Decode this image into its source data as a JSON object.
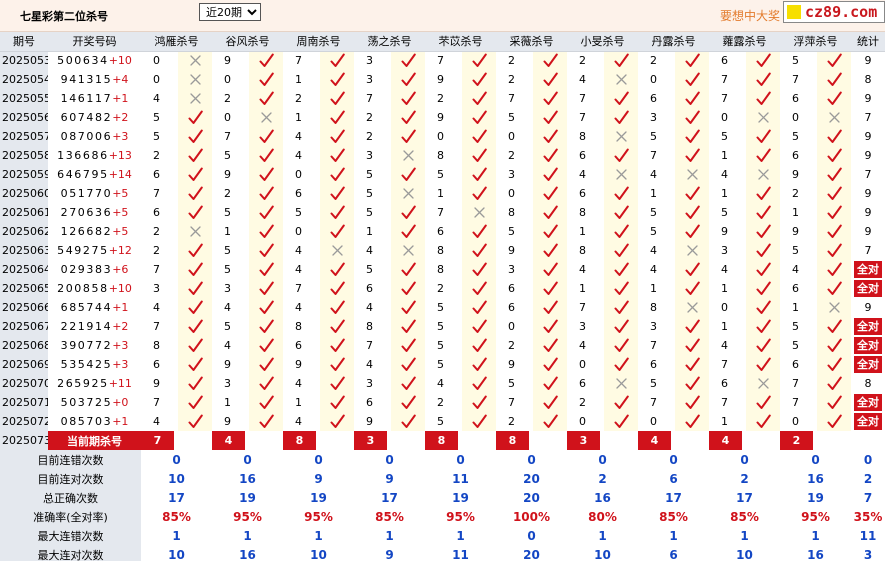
{
  "header": {
    "title": "七星彩第二位杀号",
    "period_select": {
      "selected": "近20期",
      "options": [
        "近20期"
      ]
    },
    "slogan": "要想中大奖",
    "logo_text": "cz89.com"
  },
  "table": {
    "col_issue": "期号",
    "col_numbers": "开奖号码",
    "col_stat": "统计",
    "experts": [
      "鸿雁杀号",
      "谷风杀号",
      "周南杀号",
      "荡之杀号",
      "芣苡杀号",
      "采薇杀号",
      "小旻杀号",
      "丹露杀号",
      "蕹露杀号",
      "浮萍杀号"
    ],
    "full_label": "全对",
    "rows": [
      {
        "issue": "2025053",
        "numbers": "500634",
        "plus": "+10",
        "kills": [
          "0",
          "9",
          "7",
          "3",
          "7",
          "2",
          "2",
          "2",
          "6",
          "5"
        ],
        "marks": [
          0,
          1,
          1,
          1,
          1,
          1,
          1,
          1,
          1,
          1
        ],
        "stat": "9"
      },
      {
        "issue": "2025054",
        "numbers": "941315",
        "plus": "+4",
        "kills": [
          "0",
          "0",
          "1",
          "3",
          "9",
          "2",
          "4",
          "0",
          "7",
          "7"
        ],
        "marks": [
          0,
          1,
          1,
          1,
          1,
          1,
          0,
          1,
          1,
          1
        ],
        "stat": "8"
      },
      {
        "issue": "2025055",
        "numbers": "146117",
        "plus": "+1",
        "kills": [
          "4",
          "2",
          "2",
          "7",
          "2",
          "7",
          "7",
          "6",
          "7",
          "6"
        ],
        "marks": [
          0,
          1,
          1,
          1,
          1,
          1,
          1,
          1,
          1,
          1
        ],
        "stat": "9"
      },
      {
        "issue": "2025056",
        "numbers": "607482",
        "plus": "+2",
        "kills": [
          "5",
          "0",
          "1",
          "2",
          "9",
          "5",
          "7",
          "3",
          "0",
          "0"
        ],
        "marks": [
          1,
          0,
          1,
          1,
          1,
          1,
          1,
          1,
          0,
          0
        ],
        "stat": "7"
      },
      {
        "issue": "2025057",
        "numbers": "087006",
        "plus": "+3",
        "kills": [
          "5",
          "7",
          "4",
          "2",
          "0",
          "0",
          "8",
          "5",
          "5",
          "5"
        ],
        "marks": [
          1,
          1,
          1,
          1,
          1,
          1,
          0,
          1,
          1,
          1
        ],
        "stat": "9"
      },
      {
        "issue": "2025058",
        "numbers": "136686",
        "plus": "+13",
        "kills": [
          "2",
          "5",
          "4",
          "3",
          "8",
          "2",
          "6",
          "7",
          "1",
          "6"
        ],
        "marks": [
          1,
          1,
          1,
          0,
          1,
          1,
          1,
          1,
          1,
          1
        ],
        "stat": "9"
      },
      {
        "issue": "2025059",
        "numbers": "646795",
        "plus": "+14",
        "kills": [
          "6",
          "9",
          "0",
          "5",
          "5",
          "3",
          "4",
          "4",
          "4",
          "9"
        ],
        "marks": [
          1,
          1,
          1,
          1,
          1,
          1,
          0,
          0,
          0,
          1
        ],
        "stat": "7"
      },
      {
        "issue": "2025060",
        "numbers": "051770",
        "plus": "+5",
        "kills": [
          "7",
          "2",
          "6",
          "5",
          "1",
          "0",
          "6",
          "1",
          "1",
          "2"
        ],
        "marks": [
          1,
          1,
          1,
          0,
          1,
          1,
          1,
          1,
          1,
          1
        ],
        "stat": "9"
      },
      {
        "issue": "2025061",
        "numbers": "270636",
        "plus": "+5",
        "kills": [
          "6",
          "5",
          "5",
          "5",
          "7",
          "8",
          "8",
          "5",
          "5",
          "1"
        ],
        "marks": [
          1,
          1,
          1,
          1,
          0,
          1,
          1,
          1,
          1,
          1
        ],
        "stat": "9"
      },
      {
        "issue": "2025062",
        "numbers": "126682",
        "plus": "+5",
        "kills": [
          "2",
          "1",
          "0",
          "1",
          "6",
          "5",
          "1",
          "5",
          "9",
          "9"
        ],
        "marks": [
          0,
          1,
          1,
          1,
          1,
          1,
          1,
          1,
          1,
          1
        ],
        "stat": "9"
      },
      {
        "issue": "2025063",
        "numbers": "549275",
        "plus": "+12",
        "kills": [
          "2",
          "5",
          "4",
          "4",
          "8",
          "9",
          "8",
          "4",
          "3",
          "5"
        ],
        "marks": [
          1,
          1,
          0,
          0,
          1,
          1,
          1,
          0,
          1,
          1
        ],
        "stat": "7"
      },
      {
        "issue": "2025064",
        "numbers": "029383",
        "plus": "+6",
        "kills": [
          "7",
          "5",
          "4",
          "5",
          "8",
          "3",
          "4",
          "4",
          "4",
          "4"
        ],
        "marks": [
          1,
          1,
          1,
          1,
          1,
          1,
          1,
          1,
          1,
          1
        ],
        "stat": "full"
      },
      {
        "issue": "2025065",
        "numbers": "200858",
        "plus": "+10",
        "kills": [
          "3",
          "3",
          "7",
          "6",
          "2",
          "6",
          "1",
          "1",
          "1",
          "6"
        ],
        "marks": [
          1,
          1,
          1,
          1,
          1,
          1,
          1,
          1,
          1,
          1
        ],
        "stat": "full"
      },
      {
        "issue": "2025066",
        "numbers": "685744",
        "plus": "+1",
        "kills": [
          "4",
          "4",
          "4",
          "4",
          "5",
          "6",
          "7",
          "8",
          "0",
          "1"
        ],
        "marks": [
          1,
          1,
          1,
          1,
          1,
          1,
          1,
          0,
          1,
          0
        ],
        "stat": "9"
      },
      {
        "issue": "2025067",
        "numbers": "221914",
        "plus": "+2",
        "kills": [
          "7",
          "5",
          "8",
          "8",
          "5",
          "0",
          "3",
          "3",
          "1",
          "5"
        ],
        "marks": [
          1,
          1,
          1,
          1,
          1,
          1,
          1,
          1,
          1,
          1
        ],
        "stat": "full"
      },
      {
        "issue": "2025068",
        "numbers": "390772",
        "plus": "+3",
        "kills": [
          "8",
          "4",
          "6",
          "7",
          "5",
          "2",
          "4",
          "7",
          "4",
          "5"
        ],
        "marks": [
          1,
          1,
          1,
          1,
          1,
          1,
          1,
          1,
          1,
          1
        ],
        "stat": "full"
      },
      {
        "issue": "2025069",
        "numbers": "535425",
        "plus": "+3",
        "kills": [
          "6",
          "9",
          "9",
          "4",
          "5",
          "9",
          "0",
          "6",
          "7",
          "6"
        ],
        "marks": [
          1,
          1,
          1,
          1,
          1,
          1,
          1,
          1,
          1,
          1
        ],
        "stat": "full"
      },
      {
        "issue": "2025070",
        "numbers": "265925",
        "plus": "+11",
        "kills": [
          "9",
          "3",
          "4",
          "3",
          "4",
          "5",
          "6",
          "5",
          "6",
          "7"
        ],
        "marks": [
          1,
          1,
          1,
          1,
          1,
          1,
          0,
          1,
          0,
          1
        ],
        "stat": "8"
      },
      {
        "issue": "2025071",
        "numbers": "503725",
        "plus": "+0",
        "kills": [
          "7",
          "1",
          "1",
          "6",
          "2",
          "7",
          "2",
          "7",
          "7",
          "7"
        ],
        "marks": [
          1,
          1,
          1,
          1,
          1,
          1,
          1,
          1,
          1,
          1
        ],
        "stat": "full"
      },
      {
        "issue": "2025072",
        "numbers": "085703",
        "plus": "+1",
        "kills": [
          "4",
          "9",
          "4",
          "9",
          "5",
          "2",
          "0",
          "0",
          "1",
          "0"
        ],
        "marks": [
          1,
          1,
          1,
          1,
          1,
          1,
          1,
          1,
          1,
          1
        ],
        "stat": "full"
      }
    ],
    "current": {
      "issue": "2025073",
      "label": "当前期杀号",
      "kills": [
        "7",
        "4",
        "8",
        "3",
        "8",
        "8",
        "3",
        "4",
        "4",
        "2"
      ]
    },
    "summary": [
      {
        "label": "目前连错次数",
        "values": [
          "0",
          "0",
          "0",
          "0",
          "0",
          "0",
          "0",
          "0",
          "0",
          "0"
        ],
        "stat": "0",
        "color": "blue"
      },
      {
        "label": "目前连对次数",
        "values": [
          "10",
          "16",
          "9",
          "9",
          "11",
          "20",
          "2",
          "6",
          "2",
          "16"
        ],
        "stat": "2",
        "color": "blue"
      },
      {
        "label": "总正确次数",
        "values": [
          "17",
          "19",
          "19",
          "17",
          "19",
          "20",
          "16",
          "17",
          "17",
          "19"
        ],
        "stat": "7",
        "color": "blue"
      },
      {
        "label": "准确率(全对率)",
        "values": [
          "85%",
          "95%",
          "95%",
          "85%",
          "95%",
          "100%",
          "80%",
          "85%",
          "85%",
          "95%"
        ],
        "stat": "35%",
        "color": "red"
      },
      {
        "label": "最大连错次数",
        "values": [
          "1",
          "1",
          "1",
          "1",
          "1",
          "0",
          "1",
          "1",
          "1",
          "1"
        ],
        "stat": "11",
        "color": "blue"
      },
      {
        "label": "最大连对次数",
        "values": [
          "10",
          "16",
          "10",
          "9",
          "11",
          "20",
          "10",
          "6",
          "10",
          "16"
        ],
        "stat": "3",
        "color": "blue"
      }
    ],
    "colors": {
      "check": "#d0121b",
      "cross": "#9a9a9a",
      "accent": "#d0121b",
      "blue": "#1346c4",
      "header_bg": "#e4e8ee",
      "mark_bg": "#fffbe3"
    }
  }
}
